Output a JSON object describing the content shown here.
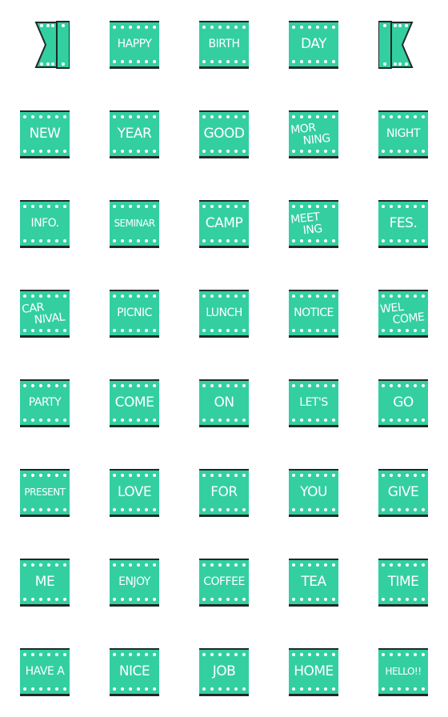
{
  "colors": {
    "tile": "#33cfa1",
    "border": "#1e2b26",
    "text": "#ffffff"
  },
  "rows": [
    [
      "ribbon-left",
      "HAPPY",
      "BIRTH",
      "DAY",
      "ribbon-right"
    ],
    [
      "NEW",
      "YEAR",
      "GOOD",
      "MOR|NING",
      "NIGHT"
    ],
    [
      "INFO.",
      "SEMINAR",
      "CAMP",
      "MEET|ING",
      "FES."
    ],
    [
      "CAR|NIVAL",
      "PICNIC",
      "LUNCH",
      "NOTICE",
      "WEL|COME"
    ],
    [
      "PARTY",
      "COME",
      "ON",
      "LET'S",
      "GO"
    ],
    [
      "PRESENT",
      "LOVE",
      "FOR",
      "YOU",
      "GIVE"
    ],
    [
      "ME",
      "ENJOY",
      "COFFEE",
      "TEA",
      "TIME"
    ],
    [
      "HAVE A",
      "NICE",
      "JOB",
      "HOME",
      "HELLO!!"
    ]
  ]
}
